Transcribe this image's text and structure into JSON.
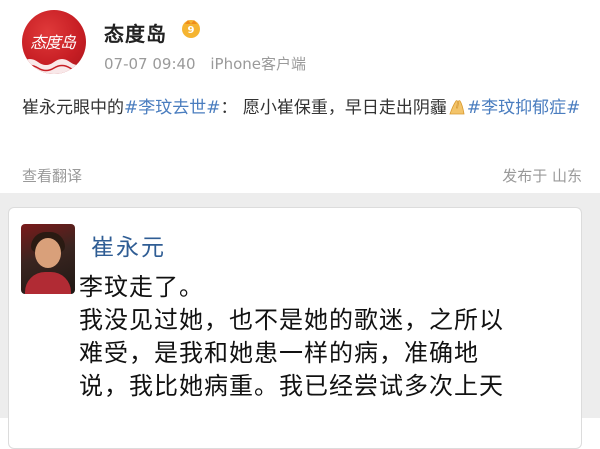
{
  "post": {
    "author": "态度岛",
    "avatar_text": "态度岛",
    "date": "07-07 09:40",
    "source": "iPhone客户端",
    "text_prefix": "崔永元眼中的",
    "hashtag_1": "#李玟去世#",
    "text_middle": "： 愿小崔保重，早日走出阴霾",
    "hashtag_2": "#李玟抑郁症#",
    "translate_link": "查看翻译",
    "location": "发布于 山东",
    "icons": {
      "author_badge": "vip-badge-icon",
      "emoji": "praying-hands-icon"
    }
  },
  "embed": {
    "author": "崔永元",
    "lines": [
      "李玟走了。",
      "我没见过她，也不是她的歌迷，之所以",
      "难受，是我和她患一样的病，准确地",
      "说，我比她病重。我已经尝试多次上天"
    ]
  },
  "colors": {
    "hashtag": "#4a7dbf",
    "avatar_red": "#c81f25",
    "inner_name": "#2f5d94"
  }
}
